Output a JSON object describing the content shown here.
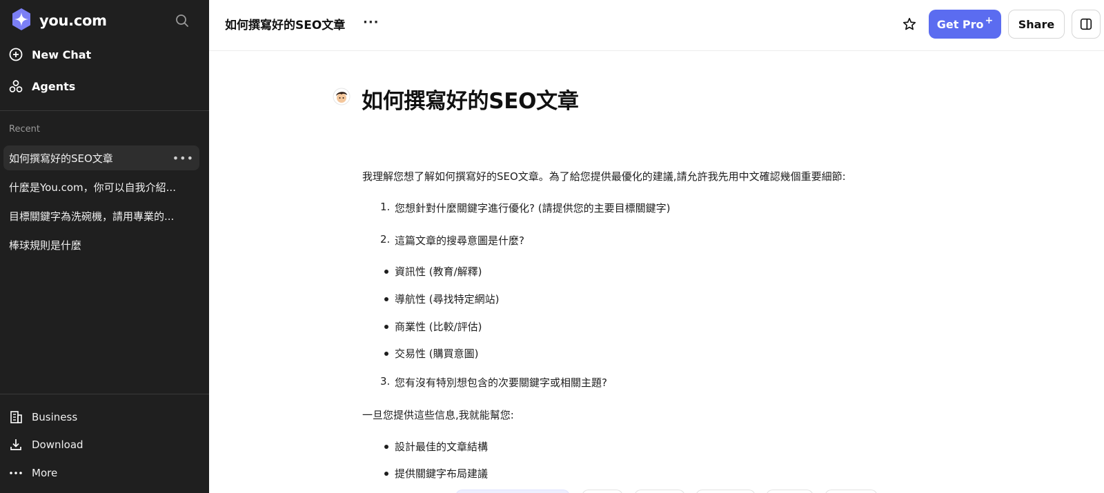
{
  "sidebar": {
    "brand": "you.com",
    "new_chat": "New Chat",
    "agents": "Agents",
    "recent_label": "Recent",
    "recent": [
      {
        "title": "如何撰寫好的SEO文章"
      },
      {
        "title": "什麼是You.com，你可以自我介紹..."
      },
      {
        "title": "目標關鍵字為洗碗機，請用專業的..."
      },
      {
        "title": "棒球規則是什麼"
      }
    ],
    "bottom": {
      "business": "Business",
      "download": "Download",
      "more": "More"
    }
  },
  "topbar": {
    "title": "如何撰寫好的SEO文章",
    "more": "···",
    "get_pro": "Get Pro",
    "pro_plus": "+",
    "share": "Share"
  },
  "content": {
    "title": "如何撰寫好的SEO文章",
    "intro": "我理解您想了解如何撰寫好的SEO文章。為了給您提供最優化的建議,請允許我先用中文確認幾個重要細節:",
    "q1": "您想針對什麼關鍵字進行優化? (請提供您的主要目標關鍵字)",
    "q2": "這篇文章的搜尋意圖是什麼?",
    "intents": [
      "資訊性 (教育/解釋)",
      "導航性 (尋找特定網站)",
      "商業性 (比較/評估)",
      "交易性 (購買意圖)"
    ],
    "q3": "您有沒有特別想包含的次要關鍵字或相關主題?",
    "after": "一旦您提供這些信息,我就能幫您:",
    "helps": [
      "設計最佳的文章結構",
      "提供關鍵字布局建議"
    ],
    "num1": "1.",
    "num2": "2.",
    "num3": "3."
  },
  "colors": {
    "sidebar_bg": "#1f1f1f",
    "accent": "#5b6cf0",
    "logo": "#7b7ff5"
  },
  "icons": [
    "you-logo-icon",
    "search-icon",
    "plus-circle-icon",
    "agents-icon",
    "more-dots-icon",
    "building-icon",
    "download-icon",
    "star-icon",
    "sidebar-panel-icon",
    "avatar"
  ]
}
